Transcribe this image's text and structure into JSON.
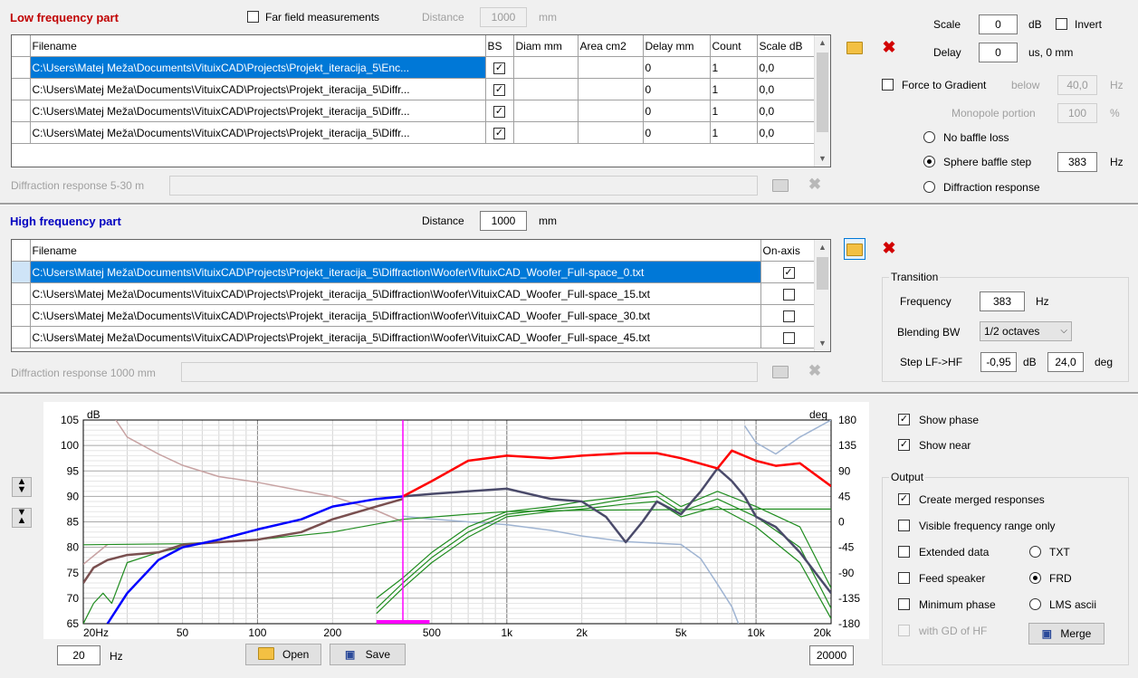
{
  "lf": {
    "title": "Low frequency part",
    "far_field_label": "Far field measurements",
    "distance_label": "Distance",
    "distance_value": "1000",
    "distance_unit": "mm",
    "columns": [
      "Filename",
      "BS",
      "Diam mm",
      "Area cm2",
      "Delay mm",
      "Count",
      "Scale dB"
    ],
    "rows": [
      {
        "filename": "C:\\Users\\Matej Meža\\Documents\\VituixCAD\\Projects\\Projekt_iteracija_5\\Enc...",
        "bs": "✓",
        "diam": "",
        "area": "",
        "delay": "0",
        "count": "1",
        "scale": "0,0"
      },
      {
        "filename": "C:\\Users\\Matej Meža\\Documents\\VituixCAD\\Projects\\Projekt_iteracija_5\\Diffr...",
        "bs": "✓",
        "diam": "",
        "area": "",
        "delay": "0",
        "count": "1",
        "scale": "0,0"
      },
      {
        "filename": "C:\\Users\\Matej Meža\\Documents\\VituixCAD\\Projects\\Projekt_iteracija_5\\Diffr...",
        "bs": "✓",
        "diam": "",
        "area": "",
        "delay": "0",
        "count": "1",
        "scale": "0,0"
      },
      {
        "filename": "C:\\Users\\Matej Meža\\Documents\\VituixCAD\\Projects\\Projekt_iteracija_5\\Diffr...",
        "bs": "✓",
        "diam": "",
        "area": "",
        "delay": "0",
        "count": "1",
        "scale": "0,0"
      }
    ],
    "diffraction_label": "Diffraction response 5-30 m"
  },
  "right_top": {
    "scale_label": "Scale",
    "scale_value": "0",
    "scale_unit": "dB",
    "invert_label": "Invert",
    "delay_label": "Delay",
    "delay_value": "0",
    "delay_unit": "us,  0 mm",
    "force_gradient_label": "Force to Gradient",
    "below_label": "below",
    "below_value": "40,0",
    "below_unit": "Hz",
    "monopole_label": "Monopole portion",
    "monopole_value": "100",
    "monopole_unit": "%",
    "no_baffle_label": "No baffle loss",
    "sphere_label": "Sphere baffle step",
    "sphere_value": "383",
    "sphere_unit": "Hz",
    "diffraction_resp_label": "Diffraction response"
  },
  "hf": {
    "title": "High frequency part",
    "distance_label": "Distance",
    "distance_value": "1000",
    "distance_unit": "mm",
    "columns": [
      "Filename",
      "On-axis"
    ],
    "rows": [
      {
        "filename": "C:\\Users\\Matej Meža\\Documents\\VituixCAD\\Projects\\Projekt_iteracija_5\\Diffraction\\Woofer\\VituixCAD_Woofer_Full-space_0.txt",
        "onaxis": "✓"
      },
      {
        "filename": "C:\\Users\\Matej Meža\\Documents\\VituixCAD\\Projects\\Projekt_iteracija_5\\Diffraction\\Woofer\\VituixCAD_Woofer_Full-space_15.txt",
        "onaxis": ""
      },
      {
        "filename": "C:\\Users\\Matej Meža\\Documents\\VituixCAD\\Projects\\Projekt_iteracija_5\\Diffraction\\Woofer\\VituixCAD_Woofer_Full-space_30.txt",
        "onaxis": ""
      },
      {
        "filename": "C:\\Users\\Matej Meža\\Documents\\VituixCAD\\Projects\\Projekt_iteracija_5\\Diffraction\\Woofer\\VituixCAD_Woofer_Full-space_45.txt",
        "onaxis": ""
      }
    ],
    "diffraction_label": "Diffraction response 1000 mm"
  },
  "transition": {
    "title": "Transition",
    "frequency_label": "Frequency",
    "frequency_value": "383",
    "frequency_unit": "Hz",
    "blending_label": "Blending BW",
    "blending_value": "1/2 octaves",
    "step_label": "Step LF->HF",
    "step_db_value": "-0,95",
    "step_db_unit": "dB",
    "step_deg_value": "24,0",
    "step_deg_unit": "deg"
  },
  "options": {
    "show_phase_label": "Show phase",
    "show_phase": true,
    "show_near_label": "Show near",
    "show_near": true,
    "output_title": "Output",
    "create_merged_label": "Create merged responses",
    "create_merged": true,
    "visible_range_label": "Visible frequency range only",
    "extended_label": "Extended data",
    "feed_label": "Feed speaker",
    "min_phase_label": "Minimum phase",
    "gd_label": "with GD of HF",
    "txt_label": "TXT",
    "frd_label": "FRD",
    "lms_label": "LMS ascii",
    "merge_label": "Merge"
  },
  "bottom": {
    "fmin_value": "20",
    "fmin_unit": "Hz",
    "open_label": "Open",
    "save_label": "Save",
    "fmax_value": "20000"
  },
  "colors": {
    "lf_title": "#c00000",
    "hf_title": "#0000c0",
    "selection": "#0078d7",
    "curve_red": "#ff0000",
    "curve_blue": "#0000ff",
    "curve_brown": "#7a5050",
    "curve_slate": "#4a4a6a",
    "curve_green": "#1f8c1f",
    "curve_lightblue": "#9fb4d2",
    "curve_pinkish": "#c7a2a2",
    "marker_magenta": "#ff00ff"
  },
  "chart_data": {
    "type": "line",
    "ylabel": "dB",
    "y2label": "deg",
    "xscale": "log",
    "xlim": [
      20,
      20000
    ],
    "ylim": [
      65,
      105
    ],
    "y2lim": [
      -180,
      180
    ],
    "xticklabels": [
      "20Hz",
      "50",
      "100",
      "200",
      "500",
      "1k",
      "2k",
      "5k",
      "10k",
      "20k"
    ],
    "yticklabels": [
      "105",
      "100",
      "95",
      "90",
      "85",
      "80",
      "75",
      "70",
      "65"
    ],
    "y2ticklabels": [
      "180",
      "135",
      "90",
      "45",
      "0",
      "-45",
      "-90",
      "-135",
      "-180"
    ],
    "crossover_marker_hz": 383,
    "series": [
      {
        "role": "lf_response",
        "color": "#0000ff",
        "axis": "left",
        "x": [
          25,
          30,
          40,
          50,
          70,
          100,
          150,
          200,
          300,
          383
        ],
        "y": [
          65,
          71,
          77.5,
          80,
          81.5,
          83.5,
          85.5,
          88,
          89.5,
          90
        ]
      },
      {
        "role": "lf_scaled",
        "color": "#7a5050",
        "axis": "left",
        "x": [
          20,
          22,
          25,
          30,
          40,
          50,
          70,
          100,
          150,
          200,
          300,
          383
        ],
        "y": [
          73,
          76,
          77.5,
          78.5,
          79,
          80.5,
          81,
          81.5,
          83,
          85.5,
          88,
          89.5
        ]
      },
      {
        "role": "merged_response",
        "color": "#ff0000",
        "axis": "left",
        "x": [
          383,
          500,
          700,
          1000,
          1500,
          2000,
          3000,
          4000,
          5000,
          7000,
          8000,
          10000,
          12000,
          15000,
          20000
        ],
        "y": [
          90,
          93,
          97,
          98,
          97.5,
          98,
          98.5,
          98.5,
          97.5,
          95.5,
          99,
          97,
          96,
          96.5,
          92
        ]
      },
      {
        "role": "hf_onaxis",
        "color": "#4a4a6a",
        "axis": "left",
        "x": [
          383,
          500,
          700,
          1000,
          1500,
          2000,
          2500,
          3000,
          3500,
          4000,
          5000,
          6000,
          7000,
          8000,
          9000,
          10000,
          12000,
          15000,
          20000
        ],
        "y": [
          90,
          90.5,
          91,
          91.5,
          89.5,
          89,
          86,
          81,
          85,
          89,
          86.5,
          91,
          95.5,
          93,
          90,
          86,
          84,
          79,
          71
        ]
      },
      {
        "role": "phase",
        "color": "#c7a2a2",
        "axis": "right",
        "x": [
          20,
          25,
          27,
          30,
          40,
          50,
          70,
          100,
          150,
          200,
          300,
          383
        ],
        "y": [
          -75,
          -40,
          180,
          150,
          120,
          100,
          80,
          70,
          55,
          45,
          20,
          0
        ]
      },
      {
        "role": "hf_phase",
        "color": "#9fb4d2",
        "axis": "right",
        "x": [
          383,
          500,
          700,
          1000,
          1500,
          2000,
          3000,
          5000,
          6000,
          7000,
          8000,
          8500,
          9000,
          10000,
          12000,
          15000,
          20000
        ],
        "y": [
          10,
          5,
          0,
          -5,
          -15,
          -25,
          -35,
          -40,
          -65,
          -110,
          -150,
          -180,
          170,
          140,
          120,
          150,
          180
        ]
      },
      {
        "role": "baffle_step",
        "color": "#1f8c1f",
        "axis": "left",
        "x": [
          20,
          50,
          100,
          200,
          383,
          700,
          1000,
          2000,
          5000,
          10000,
          20000
        ],
        "y": [
          80.5,
          80.7,
          81.5,
          83,
          85.5,
          86.5,
          87,
          87.3,
          87.4,
          87.5,
          87.5
        ]
      },
      {
        "role": "hf_offaxis_15",
        "color": "#1f8c1f",
        "axis": "left",
        "x": [
          300,
          383,
          500,
          700,
          1000,
          1500,
          2000,
          3000,
          4000,
          5000,
          7000,
          10000,
          15000,
          20000
        ],
        "y": [
          70,
          74,
          79,
          84,
          87,
          88,
          89,
          90,
          91,
          88,
          91,
          88,
          84,
          72
        ]
      },
      {
        "role": "hf_offaxis_30",
        "color": "#1f8c1f",
        "axis": "left",
        "x": [
          300,
          383,
          500,
          700,
          1000,
          1500,
          2000,
          3000,
          4000,
          5000,
          7000,
          10000,
          15000,
          20000
        ],
        "y": [
          68,
          73,
          78,
          83,
          86.5,
          87.5,
          88,
          89.5,
          90,
          87,
          89.5,
          86,
          80,
          68
        ]
      },
      {
        "role": "hf_offaxis_45",
        "color": "#1f8c1f",
        "axis": "left",
        "x": [
          300,
          383,
          500,
          700,
          1000,
          1500,
          2000,
          3000,
          4000,
          5000,
          7000,
          10000,
          15000,
          20000
        ],
        "y": [
          67,
          72,
          77,
          82,
          86,
          87,
          87.5,
          88.5,
          89,
          86,
          88,
          84,
          77,
          66
        ]
      },
      {
        "role": "lf_nearfield_green",
        "color": "#1f8c1f",
        "axis": "left",
        "x": [
          20,
          22,
          24,
          26,
          30,
          40,
          50
        ],
        "y": [
          65,
          69,
          71,
          69,
          77,
          79,
          80
        ]
      }
    ]
  }
}
